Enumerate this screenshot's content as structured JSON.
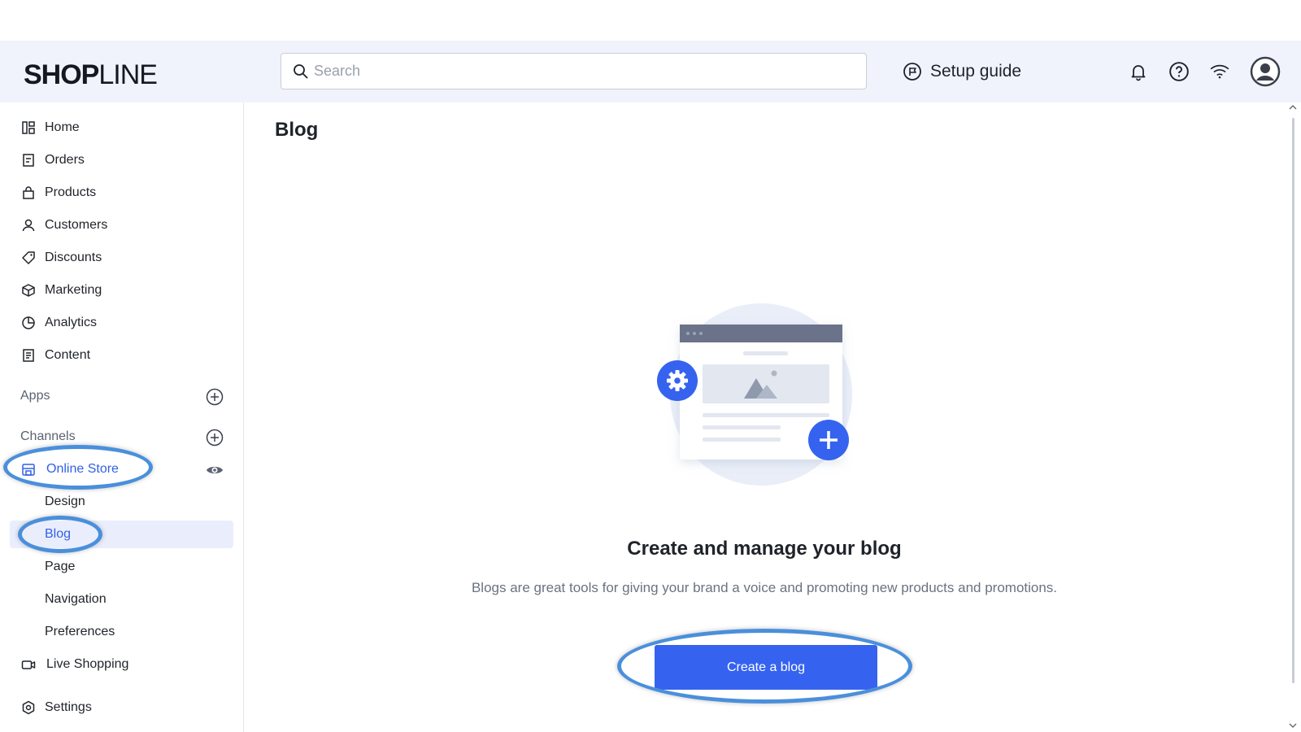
{
  "header": {
    "logo_bold": "SHOP",
    "logo_thin": "LINE",
    "search_placeholder": "Search",
    "setup_guide": "Setup guide"
  },
  "sidebar": {
    "items": [
      {
        "label": "Home",
        "icon": "home-icon"
      },
      {
        "label": "Orders",
        "icon": "orders-icon"
      },
      {
        "label": "Products",
        "icon": "products-icon"
      },
      {
        "label": "Customers",
        "icon": "customers-icon"
      },
      {
        "label": "Discounts",
        "icon": "discounts-icon"
      },
      {
        "label": "Marketing",
        "icon": "marketing-icon"
      },
      {
        "label": "Analytics",
        "icon": "analytics-icon"
      },
      {
        "label": "Content",
        "icon": "content-icon"
      }
    ],
    "apps_label": "Apps",
    "channels_label": "Channels",
    "online_store": "Online Store",
    "online_store_sub": [
      "Design",
      "Blog",
      "Page",
      "Navigation",
      "Preferences"
    ],
    "live_shopping": "Live Shopping",
    "settings": "Settings"
  },
  "main": {
    "title": "Blog",
    "empty_title": "Create and manage your blog",
    "empty_desc": "Blogs are great tools for giving your brand a voice and promoting new products and promotions.",
    "create_button": "Create a blog"
  },
  "colors": {
    "accent": "#3563f0",
    "annotation": "#4a8fdb",
    "header_bg": "#f0f3fc"
  }
}
